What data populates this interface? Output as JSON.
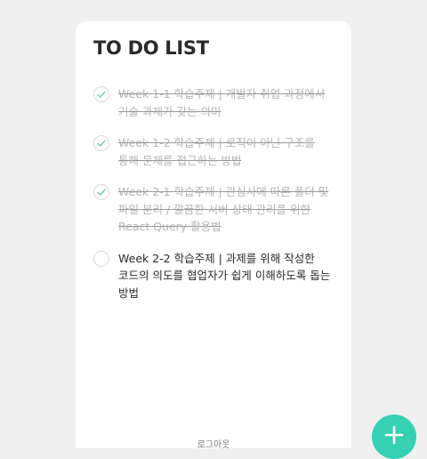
{
  "page": {
    "title": "TO DO LIST"
  },
  "todos": [
    {
      "text": "Week 1-1 학습주제 | 개발자 취업 과정에서 기술 과제가 갖는 의미",
      "done": true
    },
    {
      "text": "Week 1-2 학습주제 | 로직이 아닌 구조를 통해 문제를 접근하는 방법",
      "done": true
    },
    {
      "text": "Week 2-1 학습주제 | 관심사에 따른 폴더 및 파일 분리 / 깔끔한 서버 상태 관리를 위한 React Query 활용법",
      "done": true
    },
    {
      "text": "Week 2-2 학습주제 | 과제를 위해 작성한 코드의 의도를 협업자가 쉽게 이해하도록 돕는 방법",
      "done": false
    }
  ],
  "footer": {
    "logout_label": "로그아웃"
  },
  "icons": {
    "check": "check-icon",
    "add": "plus-icon"
  },
  "colors": {
    "accent": "#36d1b3",
    "check": "#5fc9a8",
    "done_text": "#b5b5b5",
    "text": "#2b2b2b",
    "background": "#f0f0f0"
  }
}
